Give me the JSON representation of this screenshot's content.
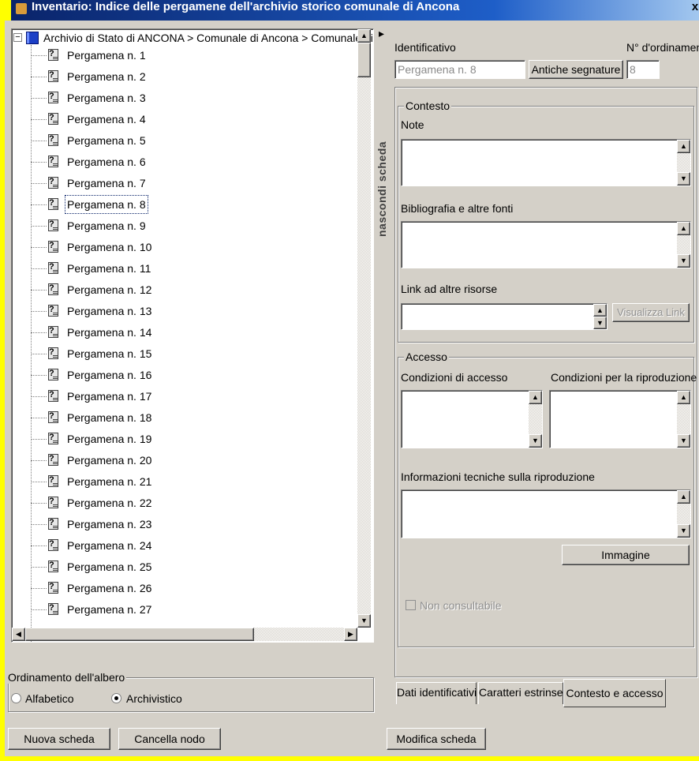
{
  "window": {
    "title": "Inventario: Indice delle pergamene dell'archivio storico comunale di Ancona",
    "close": "x"
  },
  "tree": {
    "expander": "−",
    "root_label": "Archivio di Stato di ANCONA > Comunale di Ancona > Comunale di Anco",
    "items": [
      {
        "label": "Pergamena n. 1"
      },
      {
        "label": "Pergamena n. 2"
      },
      {
        "label": "Pergamena n. 3"
      },
      {
        "label": "Pergamena n. 4"
      },
      {
        "label": "Pergamena n. 5"
      },
      {
        "label": "Pergamena n. 6"
      },
      {
        "label": "Pergamena n. 7"
      },
      {
        "label": "Pergamena n. 8"
      },
      {
        "label": "Pergamena n. 9"
      },
      {
        "label": "Pergamena n. 10"
      },
      {
        "label": "Pergamena n. 11"
      },
      {
        "label": "Pergamena n. 12"
      },
      {
        "label": "Pergamena n. 13"
      },
      {
        "label": "Pergamena n. 14"
      },
      {
        "label": "Pergamena n. 15"
      },
      {
        "label": "Pergamena n. 16"
      },
      {
        "label": "Pergamena n. 17"
      },
      {
        "label": "Pergamena n. 18"
      },
      {
        "label": "Pergamena n. 19"
      },
      {
        "label": "Pergamena n. 20"
      },
      {
        "label": "Pergamena n. 21"
      },
      {
        "label": "Pergamena n. 22"
      },
      {
        "label": "Pergamena n. 23"
      },
      {
        "label": "Pergamena n. 24"
      },
      {
        "label": "Pergamena n. 25"
      },
      {
        "label": "Pergamena n. 26"
      },
      {
        "label": "Pergamena n. 27"
      }
    ],
    "selected_index": 7,
    "item_icon_glyph": "?"
  },
  "sort": {
    "group_label": "Ordinamento dell'albero",
    "options": [
      {
        "label": "Alfabetico",
        "checked": false
      },
      {
        "label": "Archivistico",
        "checked": true
      }
    ]
  },
  "buttons": {
    "new_card": "Nuova scheda",
    "delete_node": "Cancella nodo",
    "edit_card": "Modifica scheda",
    "old_signatures": "Antiche segnature",
    "view_link": "Visualizza Link",
    "image": "Immagine"
  },
  "splitter": {
    "label": "nascondi scheda",
    "arrow": "▸"
  },
  "form": {
    "identifier_label": "Identificativo",
    "identifier_value": "Pergamena n. 8",
    "order_label": "N° d'ordinamento",
    "order_value": "8",
    "context_group": "Contesto",
    "notes_label": "Note",
    "biblio_label": "Bibliografia e altre fonti",
    "links_label": "Link ad altre risorse",
    "access_group": "Accesso",
    "access_cond_label": "Condizioni di accesso",
    "repro_cond_label": "Condizioni per la riproduzione",
    "tech_info_label": "Informazioni tecniche sulla riproduzione",
    "not_consultable_label": "Non consultabile"
  },
  "tabs": [
    {
      "label": "Dati identificativi",
      "active": false
    },
    {
      "label": "Caratteri estrinseci",
      "active": false
    },
    {
      "label": "Contesto e accesso",
      "active": true
    }
  ],
  "colors": {
    "selection_outline": "#0a246a",
    "title_bar": "#0a246a",
    "highlight_border": "#ffff00",
    "face": "#d4d0c8"
  }
}
